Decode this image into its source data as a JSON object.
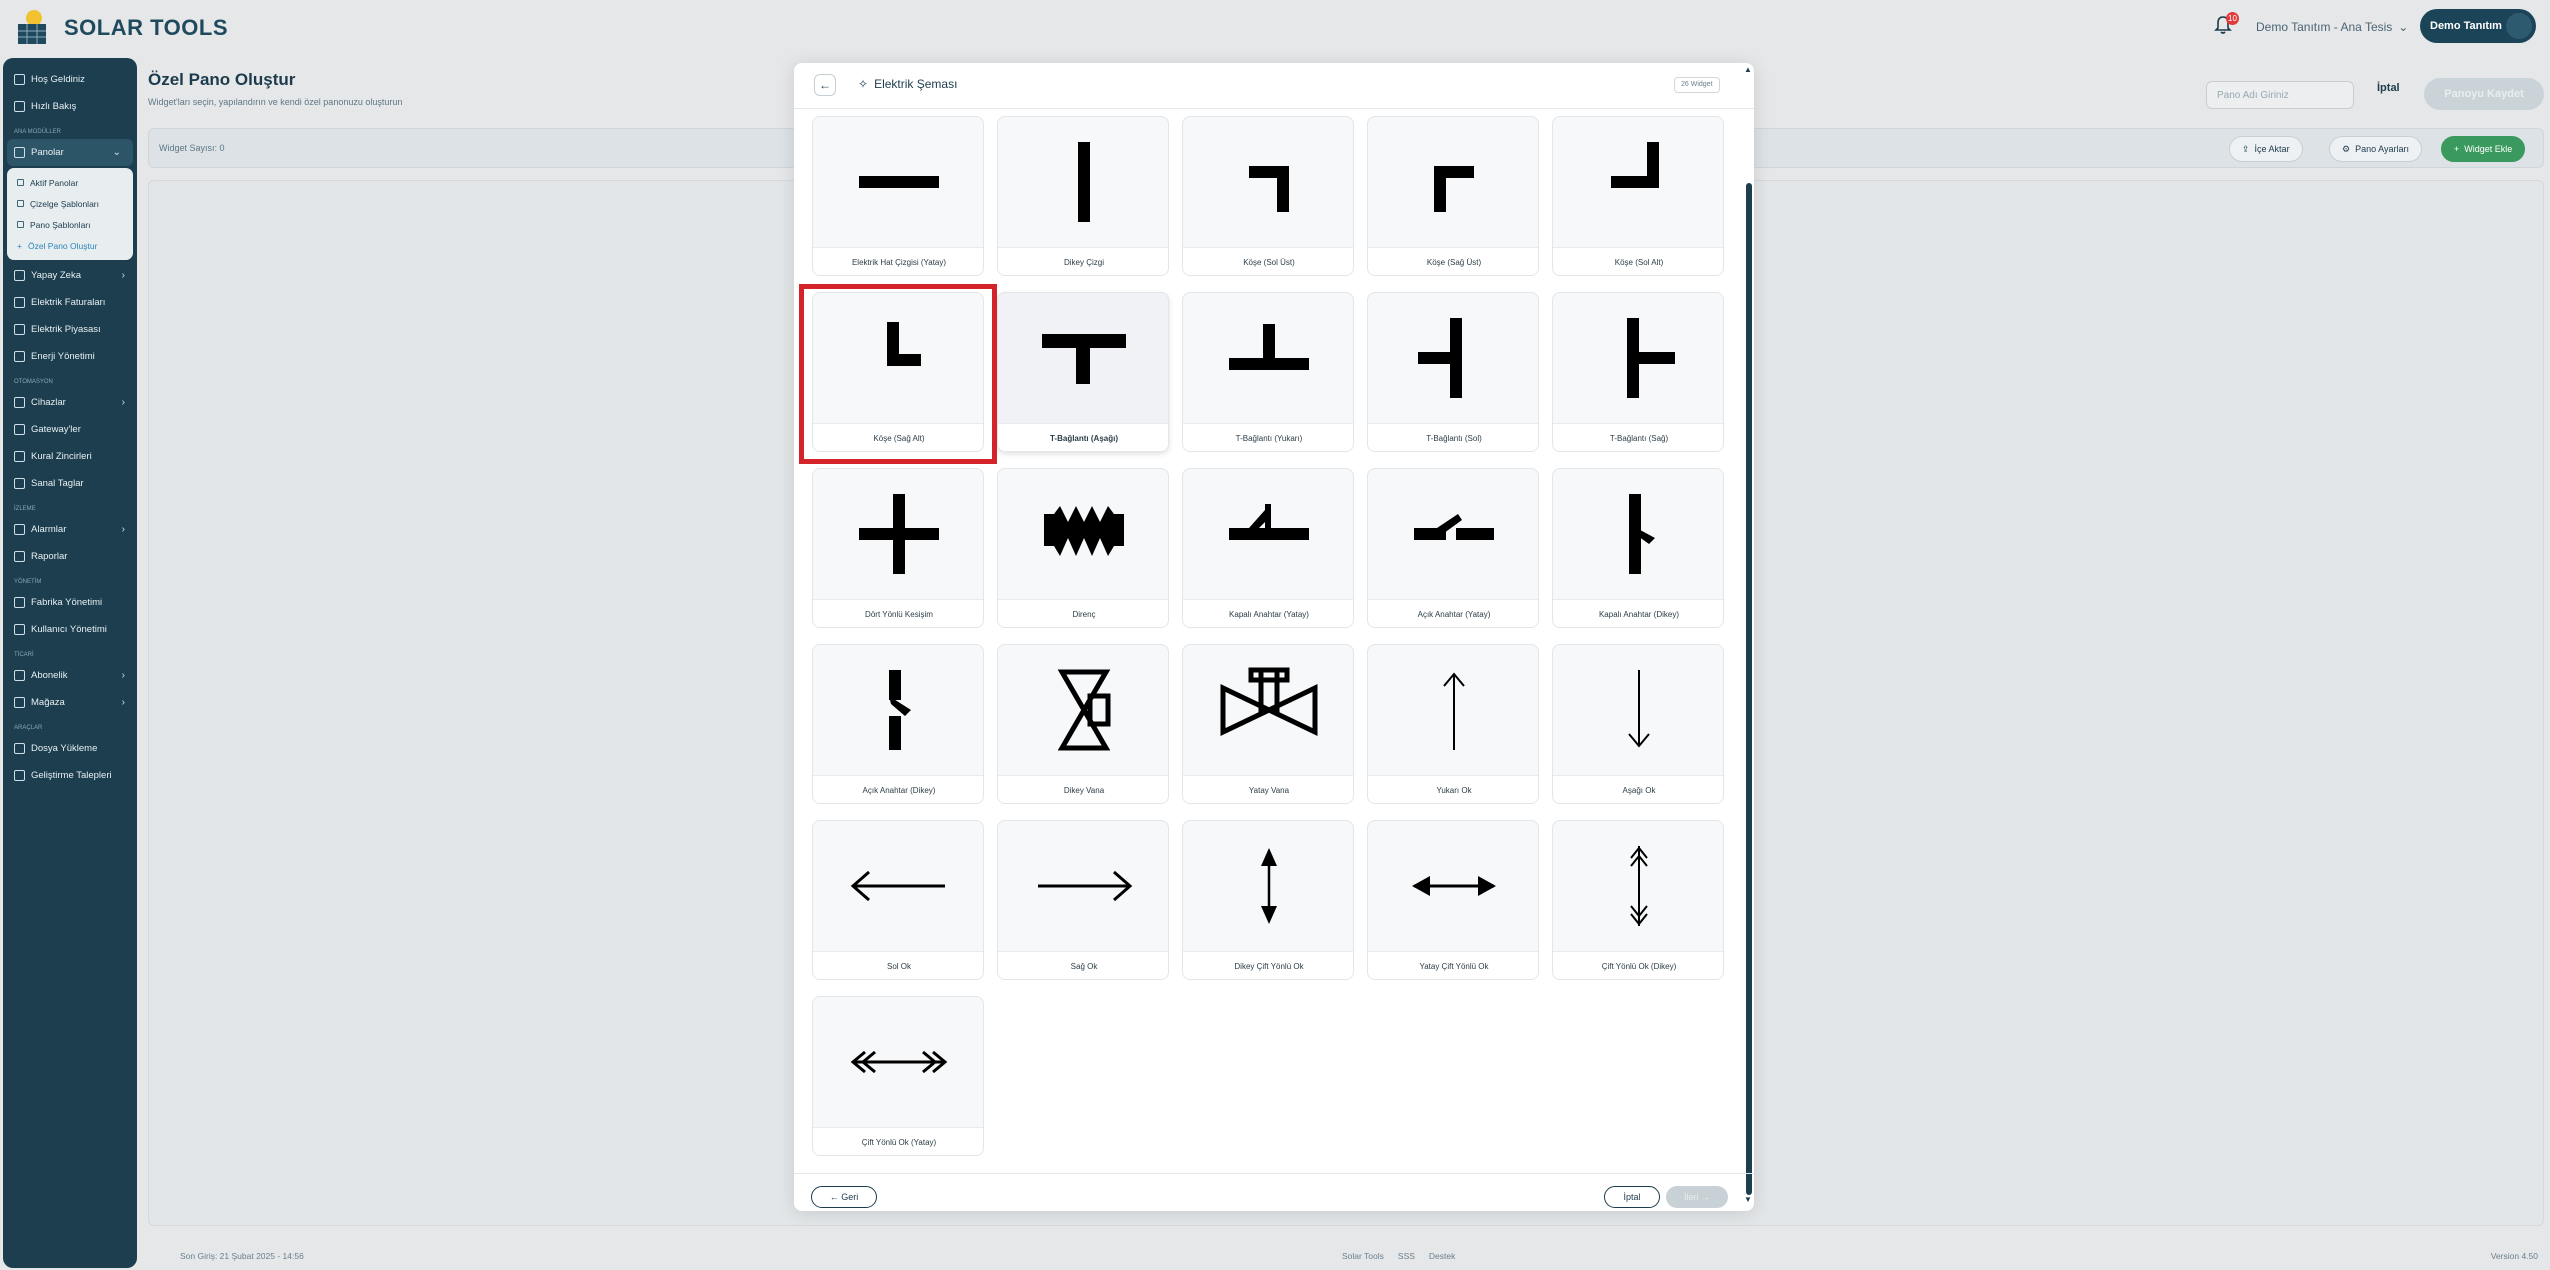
{
  "app": {
    "brand": "SOLAR TOOLS"
  },
  "header": {
    "notification_count": "10",
    "tenant": "Demo Tanıtım - Ana Tesis",
    "user": "Demo Tanıtım"
  },
  "sidebar": {
    "top_items": [
      "Hoş Geldiniz",
      "Hızlı Bakış"
    ],
    "section_dashboards": "ANA MODÜLLER",
    "dashboards_label": "Panolar",
    "dashboard_sub": [
      "Aktif Panolar",
      "Çizelge Şablonları",
      "Pano Şablonları",
      "Özel Pano Oluştur"
    ],
    "main_items": [
      "Yapay Zeka",
      "Elektrik Faturaları",
      "Elektrik Piyasası",
      "Enerji Yönetimi"
    ],
    "section_auto": "OTOMASYON",
    "auto_items": [
      "Cihazlar",
      "Gateway'ler",
      "Kural Zincirleri",
      "Sanal Taglar"
    ],
    "section_monitor": "İZLEME",
    "monitor_items": [
      "Alarmlar",
      "Raporlar"
    ],
    "section_admin": "YÖNETİM",
    "admin_items": [
      "Fabrika Yönetimi",
      "Kullanıcı Yönetimi"
    ],
    "section_commerce": "TİCARİ",
    "commerce_items": [
      "Abonelik",
      "Mağaza"
    ],
    "section_tools": "ARAÇLAR",
    "tools_items": [
      "Dosya Yükleme",
      "Geliştirme Talepleri"
    ]
  },
  "page": {
    "title": "Özel Pano Oluştur",
    "subtitle": "Widget'ları seçin, yapılandırın ve kendi özel panonuzu oluşturun",
    "name_placeholder": "Pano Adı Giriniz",
    "cancel": "İptal",
    "save": "Panoyu Kaydet",
    "widget_count": "Widget Sayısı: 0",
    "import": "İçe Aktar",
    "settings": "Pano Ayarları",
    "add_widget": "Widget Ekle"
  },
  "modal": {
    "title": "Elektrik Şeması",
    "badge": "26 Widget",
    "back": "← Geri",
    "cancel": "İptal",
    "next": "İleri →",
    "items": [
      {
        "label": "Elektrik Hat Çizgisi (Yatay)",
        "icon": "h-line"
      },
      {
        "label": "Dikey Çizgi",
        "icon": "v-line"
      },
      {
        "label": "Köşe (Sol Üst)",
        "icon": "corner-tl"
      },
      {
        "label": "Köşe (Sağ Üst)",
        "icon": "corner-tr"
      },
      {
        "label": "Köşe (Sol Alt)",
        "icon": "corner-bl"
      },
      {
        "label": "Köşe (Sağ Alt)",
        "icon": "corner-br"
      },
      {
        "label": "T-Bağlantı (Aşağı)",
        "icon": "t-down"
      },
      {
        "label": "T-Bağlantı (Yukarı)",
        "icon": "t-up"
      },
      {
        "label": "T-Bağlantı (Sol)",
        "icon": "t-left"
      },
      {
        "label": "T-Bağlantı (Sağ)",
        "icon": "t-right"
      },
      {
        "label": "Dört Yönlü Kesişim",
        "icon": "cross"
      },
      {
        "label": "Direnç",
        "icon": "resistor"
      },
      {
        "label": "Kapalı Anahtar (Yatay)",
        "icon": "switch-closed-h"
      },
      {
        "label": "Açık Anahtar (Yatay)",
        "icon": "switch-open-h"
      },
      {
        "label": "Kapalı Anahtar (Dikey)",
        "icon": "switch-closed-v"
      },
      {
        "label": "Açık Anahtar (Dikey)",
        "icon": "switch-open-v"
      },
      {
        "label": "Dikey Vana",
        "icon": "valve-v"
      },
      {
        "label": "Yatay Vana",
        "icon": "valve-h"
      },
      {
        "label": "Yukarı Ok",
        "icon": "arrow-up"
      },
      {
        "label": "Aşağı Ok",
        "icon": "arrow-down"
      },
      {
        "label": "Sol Ok",
        "icon": "arrow-left"
      },
      {
        "label": "Sağ Ok",
        "icon": "arrow-right"
      },
      {
        "label": "Dikey Çift Yönlü Ok",
        "icon": "arrow-v-double"
      },
      {
        "label": "Yatay Çift Yönlü Ok",
        "icon": "arrow-h-double"
      },
      {
        "label": "Çift Yönlü Ok (Dikey)",
        "icon": "chevron-v-double"
      },
      {
        "label": "Çift Yönlü Ok (Yatay)",
        "icon": "chevron-h-double"
      }
    ]
  },
  "footer": {
    "last_login": "Son Giriş: 21 Şubat 2025 - 14:56",
    "links": [
      "Solar Tools",
      "SSS",
      "Destek"
    ],
    "version": "Version 4.50"
  }
}
